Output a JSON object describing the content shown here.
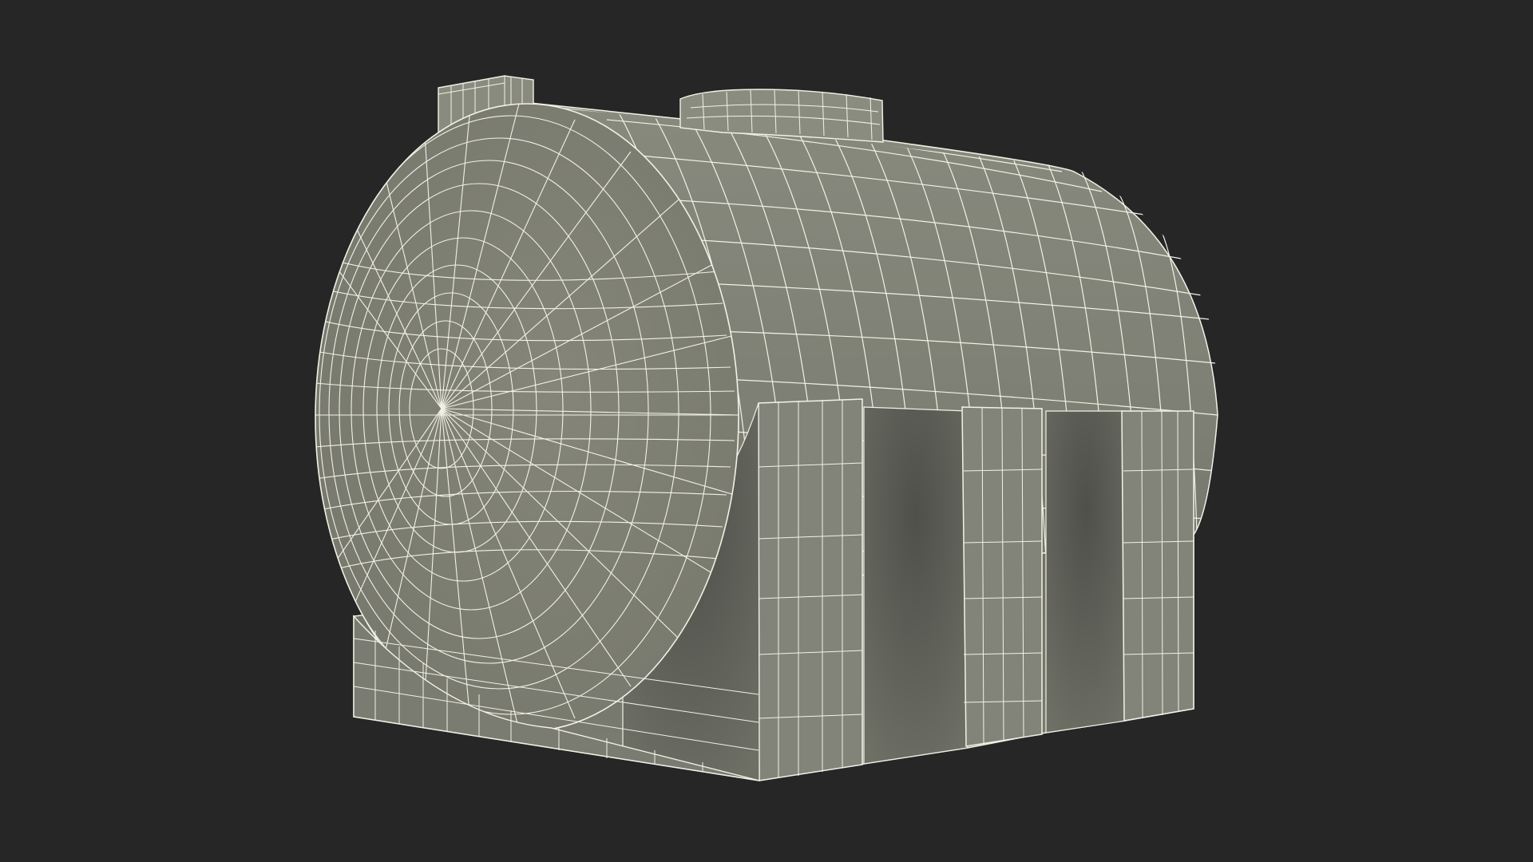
{
  "scene": {
    "subject": "horizontal-storage-tank-wireframe",
    "render_style": "wireframe-over-shaded",
    "colors": {
      "background": "#262626",
      "surface_light": "#86877c",
      "surface_mid": "#7a7b70",
      "surface_dark": "#56574f",
      "surface_shadow": "#4a4b44",
      "wire": "#f2f1e6"
    },
    "features": {
      "legs_count": 3,
      "top_hatch": true,
      "front_lug": true
    }
  }
}
